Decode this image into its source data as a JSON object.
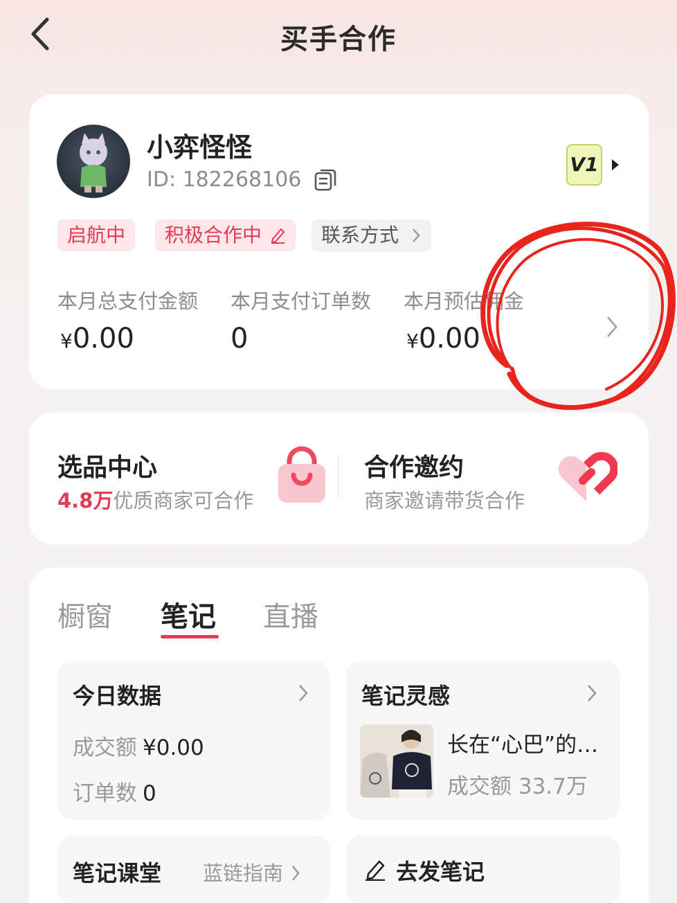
{
  "nav": {
    "title": "买手合作"
  },
  "profile": {
    "name": "小弈怪怪",
    "id_text": "ID: 182268106",
    "level": "V1",
    "tags": [
      "启航中",
      "积极合作中",
      "联系方式"
    ]
  },
  "stats": [
    {
      "label": "本月总支付金额",
      "yen": "¥",
      "value": "0.00"
    },
    {
      "label": "本月支付订单数",
      "yen": "",
      "value": "0"
    },
    {
      "label": "本月预估佣金",
      "yen": "¥",
      "value": "0.00"
    }
  ],
  "features": {
    "selection": {
      "title": "选品中心",
      "highlight": "4.8万",
      "subtitle": "优质商家可合作"
    },
    "invite": {
      "title": "合作邀约",
      "subtitle": "商家邀请带货合作"
    }
  },
  "tabs": [
    "橱窗",
    "笔记",
    "直播"
  ],
  "active_tab": "笔记",
  "today": {
    "title": "今日数据",
    "gmv_label": "成交额",
    "gmv_value": "¥0.00",
    "orders_label": "订单数",
    "orders_value": "0"
  },
  "inspiration": {
    "title": "笔记灵感",
    "note_title": "长在“心巴”的…",
    "meta": "成交额 33.7万"
  },
  "classroom": {
    "title": "笔记课堂",
    "link": "蓝链指南"
  },
  "post": {
    "label": "去发笔记"
  },
  "colors": {
    "accent": "#e23b55",
    "level_bg": "#eef5b8",
    "annotation": "#e8241c"
  }
}
